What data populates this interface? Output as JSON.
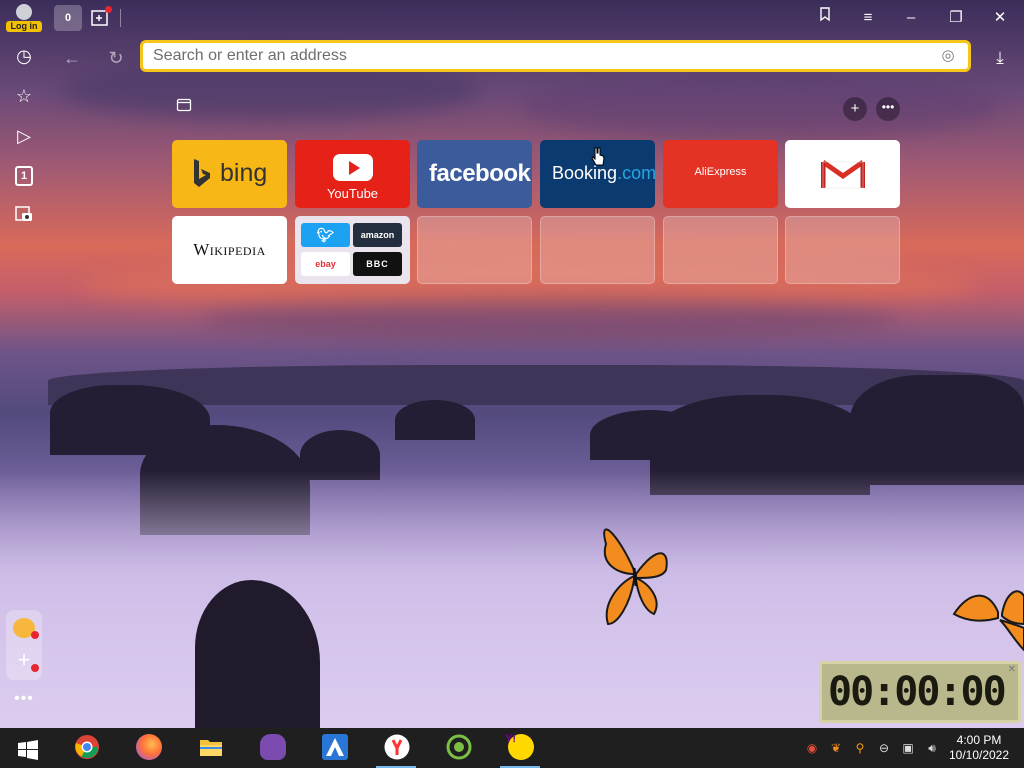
{
  "titlebar": {
    "login_label": "Log in",
    "tab_count": "0"
  },
  "toolbar": {
    "address_placeholder": "Search or enter an address"
  },
  "sidebar": {
    "items": [
      "history-icon",
      "bookmarks-icon",
      "media-icon",
      "tabs-count-icon",
      "screenshot-icon"
    ],
    "tabs_badge": "1"
  },
  "tableau": {
    "tiles": [
      {
        "name": "bing",
        "label": "bing"
      },
      {
        "name": "youtube",
        "label": "YouTube"
      },
      {
        "name": "facebook",
        "label": "facebook"
      },
      {
        "name": "booking",
        "label": "Booking",
        "suffix": ".com"
      },
      {
        "name": "aliexpress",
        "label": "AliExpress"
      },
      {
        "name": "gmail",
        "label": ""
      },
      {
        "name": "wikipedia",
        "label": "Wikipedia"
      },
      {
        "name": "folder",
        "items": [
          "twitter",
          "amazon",
          "ebay",
          "BBC"
        ]
      }
    ]
  },
  "clock": {
    "display": "00:00:00"
  },
  "taskbar": {
    "apps": [
      "start",
      "chrome",
      "firefox",
      "file-explorer",
      "bonzi",
      "arrow-app",
      "yandex-browser",
      "green-app",
      "yahoo-messenger"
    ],
    "time": "4:00 PM",
    "date": "10/10/2022"
  },
  "colors": {
    "accent": "#f5c518",
    "bing": "#f7b716",
    "youtube": "#e62117",
    "facebook": "#3b5b9b",
    "booking": "#0b3a70",
    "aliexpress": "#e43225"
  }
}
